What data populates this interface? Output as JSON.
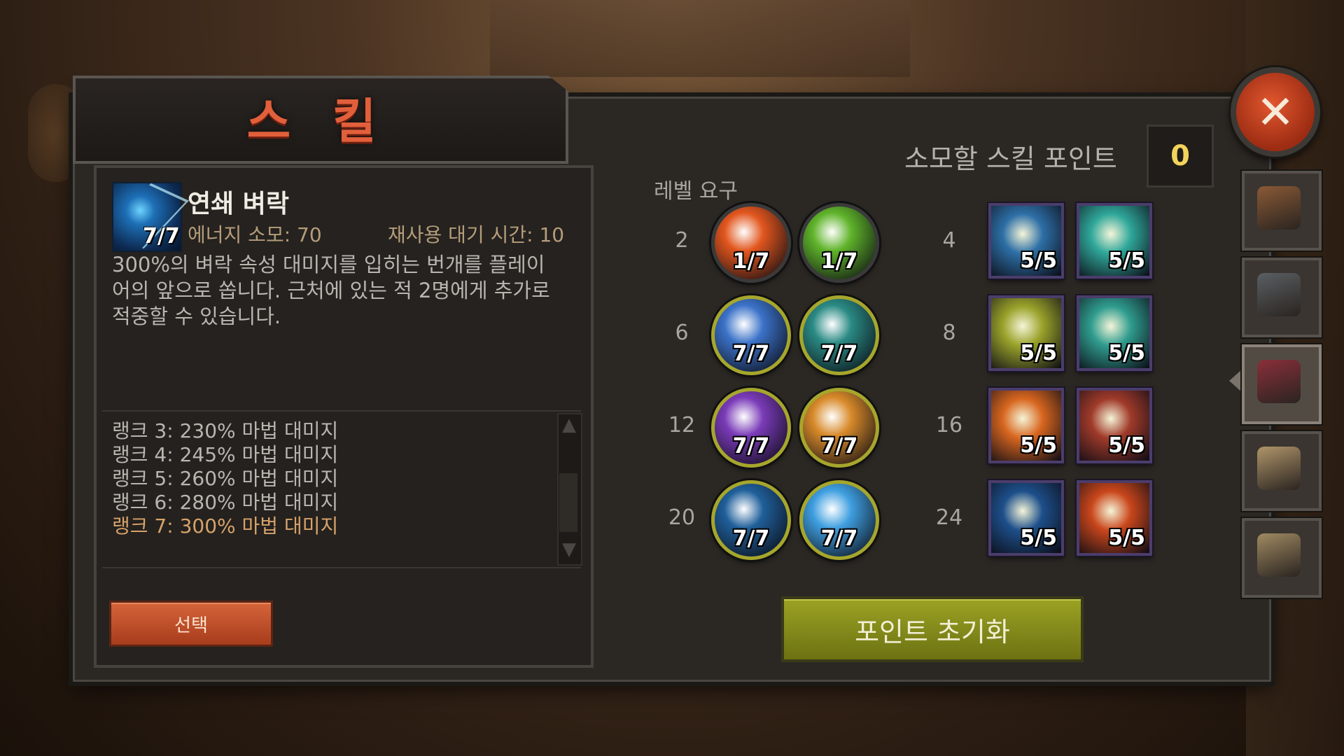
{
  "title": "스 킬",
  "detail": {
    "name": "연쇄 벼락",
    "rank": "7/7",
    "energy": "에너지 소모: 70",
    "cooldown": "재사용 대기 시간: 10",
    "description": "300%의 벼락 속성 대미지를 입히는 번개를 플레이어의 앞으로 쏩니다. 근처에 있는 적 2명에게 추가로 적중할 수 있습니다.",
    "rank_lines": [
      "랭크 3: 230% 마법 대미지",
      "랭크 4: 245% 마법 대미지",
      "랭크 5: 260% 마법 대미지",
      "랭크 6: 280% 마법 대미지",
      "랭크 7: 300% 마법 대미지"
    ],
    "select_label": "선택"
  },
  "points": {
    "label": "소모할 스킬 포인트",
    "value": "0"
  },
  "level_req_label": "레벨 요구",
  "active_levels": [
    "2",
    "6",
    "12",
    "20"
  ],
  "passive_levels": [
    "4",
    "8",
    "16",
    "24"
  ],
  "active_skills": [
    {
      "rank": "1/7",
      "icon": "fireball-icon",
      "color": "#e2561e"
    },
    {
      "rank": "1/7",
      "icon": "poison-swirl-icon",
      "color": "#5fb32a"
    },
    {
      "rank": "7/7",
      "icon": "frost-golem-icon",
      "color": "#3b72c8"
    },
    {
      "rank": "7/7",
      "icon": "lightning-fist-icon",
      "color": "#2a8a84"
    },
    {
      "rank": "7/7",
      "icon": "shadow-orb-icon",
      "color": "#7a3bb8"
    },
    {
      "rank": "7/7",
      "icon": "light-burst-icon",
      "color": "#d88a2a"
    },
    {
      "rank": "7/7",
      "icon": "chain-lightning-icon",
      "color": "#1f5f9a"
    },
    {
      "rank": "7/7",
      "icon": "snowflake-icon",
      "color": "#3f9fe0"
    }
  ],
  "passive_skills": [
    {
      "rank": "5/5",
      "icon": "spirit-figure-icon",
      "color": "#2d6fa6"
    },
    {
      "rank": "5/5",
      "icon": "arcane-slash-icon",
      "color": "#2fa79a"
    },
    {
      "rank": "5/5",
      "icon": "golden-bolt-icon",
      "color": "#9aa22a"
    },
    {
      "rank": "5/5",
      "icon": "mana-potion-icon",
      "color": "#2f9c8e"
    },
    {
      "rank": "5/5",
      "icon": "fire-ring-icon",
      "color": "#d8661f"
    },
    {
      "rank": "5/5",
      "icon": "skeleton-icon",
      "color": "#a03a2a"
    },
    {
      "rank": "5/5",
      "icon": "frost-beast-icon",
      "color": "#1d4f8a"
    },
    {
      "rank": "5/5",
      "icon": "flame-hand-icon",
      "color": "#c9461b"
    }
  ],
  "reset_label": "포인트 초기화",
  "close_label": "✕",
  "side_tabs": [
    {
      "icon": "backpack-icon"
    },
    {
      "icon": "helmet-icon"
    },
    {
      "icon": "spellbook-icon"
    },
    {
      "icon": "scroll-icon"
    },
    {
      "icon": "map-icon"
    }
  ]
}
